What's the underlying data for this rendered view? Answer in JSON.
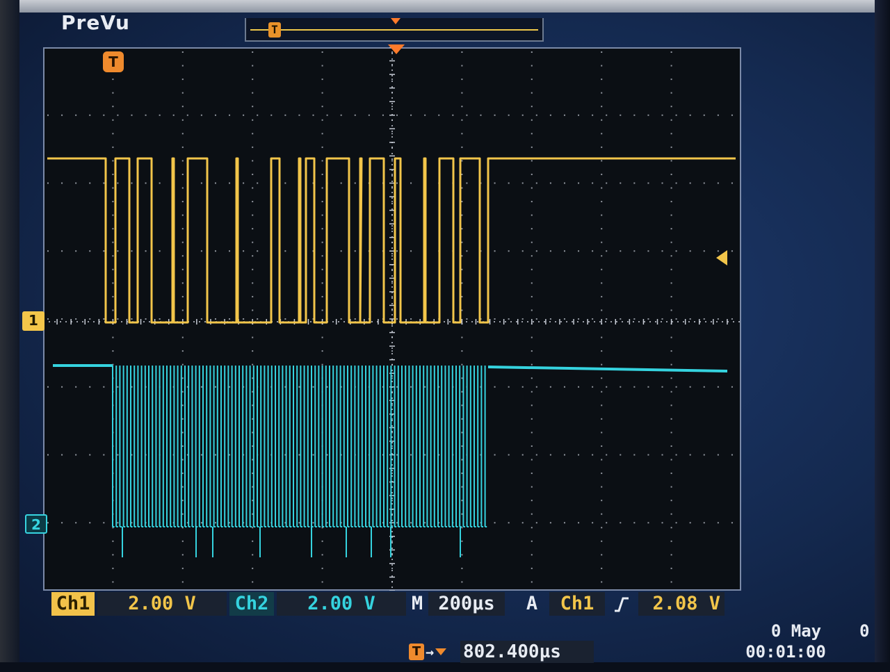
{
  "mode_label": "PreVu",
  "trigger_marker": "T",
  "channels": {
    "ch1": {
      "marker": "1",
      "tag": "Ch1",
      "scale": "2.00 V",
      "color": "#f2c54a"
    },
    "ch2": {
      "marker": "2",
      "tag": "Ch2",
      "scale": "2.00 V",
      "color": "#35d3df"
    }
  },
  "timebase": {
    "tag": "M",
    "value": "200µs"
  },
  "trigger": {
    "mode": "A",
    "source": "Ch1",
    "slope": "rising-edge-icon",
    "level": "2.08 V"
  },
  "horizontal_position": {
    "value": "802.400µs"
  },
  "clock": {
    "date": "0 May",
    "time": "00:01:00",
    "status": "0"
  },
  "colors": {
    "background": "#0b0f14",
    "grid": "#c9ced8",
    "accent": "#ef8a2d"
  }
}
